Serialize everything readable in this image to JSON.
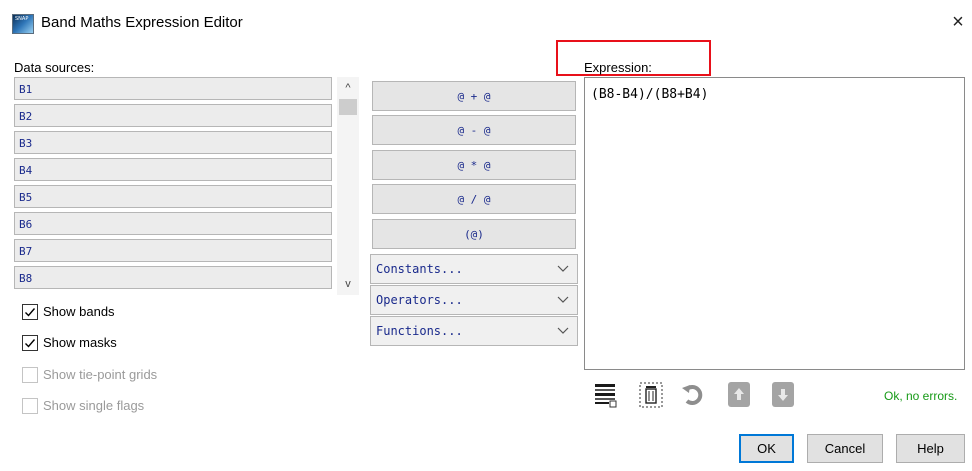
{
  "window": {
    "title": "Band Maths Expression Editor",
    "close_symbol": "×"
  },
  "data_sources": {
    "label": "Data sources:",
    "items": [
      "B1",
      "B2",
      "B3",
      "B4",
      "B5",
      "B6",
      "B7",
      "B8"
    ],
    "scroll_up": "^",
    "scroll_down": "v"
  },
  "checkboxes": [
    {
      "label": "Show bands",
      "checked": true,
      "enabled": true
    },
    {
      "label": "Show masks",
      "checked": true,
      "enabled": true
    },
    {
      "label": "Show tie-point grids",
      "checked": false,
      "enabled": false
    },
    {
      "label": "Show single flags",
      "checked": false,
      "enabled": false
    }
  ],
  "operator_buttons": [
    "@ + @",
    "@ - @",
    "@ * @",
    "@ / @",
    "(@)"
  ],
  "dropdowns": [
    "Constants...",
    "Operators...",
    "Functions..."
  ],
  "expression": {
    "label": "Expression:",
    "value": "(B8-B4)/(B8+B4)"
  },
  "toolbar_icons": [
    "expression-grid-icon",
    "clipboard-delete-icon",
    "redo-icon",
    "move-up-icon",
    "move-down-icon"
  ],
  "status": {
    "text": "Ok, no errors.",
    "color": "#179a17"
  },
  "buttons": {
    "ok": "OK",
    "cancel": "Cancel",
    "help": "Help"
  },
  "colors": {
    "highlight_box": "#e8101a",
    "mono_text": "#1a2a8c"
  }
}
